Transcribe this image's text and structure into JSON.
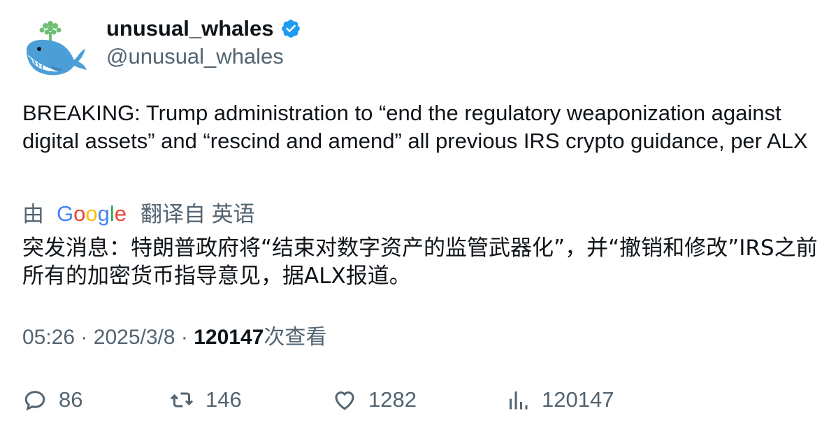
{
  "author": {
    "display_name": "unusual_whales",
    "handle": "@unusual_whales"
  },
  "tweet": {
    "text": "BREAKING: Trump administration to “end the regulatory weaponization against digital assets” and “rescind and amend” all previous IRS crypto guidance, per ALX"
  },
  "translation": {
    "prefix": "由",
    "provider_wordmark": "Google",
    "suffix": "翻译自 英语",
    "text": "突发消息：特朗普政府将“结束对数字资产的监管武器化”，并“撤销和修改”IRS之前所有的加密货币指导意见，据ALX报道。"
  },
  "meta": {
    "time": "05:26",
    "separator": "·",
    "date": "2025/3/8",
    "views_count": "120147",
    "views_label": "次查看"
  },
  "actions": {
    "reply_count": "86",
    "retweet_count": "146",
    "like_count": "1282",
    "views_count": "120147"
  },
  "colors": {
    "primary_text": "#0f1419",
    "secondary_text": "#536471",
    "verified_blue": "#1d9bf0",
    "whale_blue": "#4b9fd6"
  },
  "icons": {
    "avatar": "whale-avatar-icon",
    "verified": "verified-badge-icon",
    "reply": "reply-icon",
    "retweet": "retweet-icon",
    "like": "heart-icon",
    "views": "bar-chart-icon"
  }
}
